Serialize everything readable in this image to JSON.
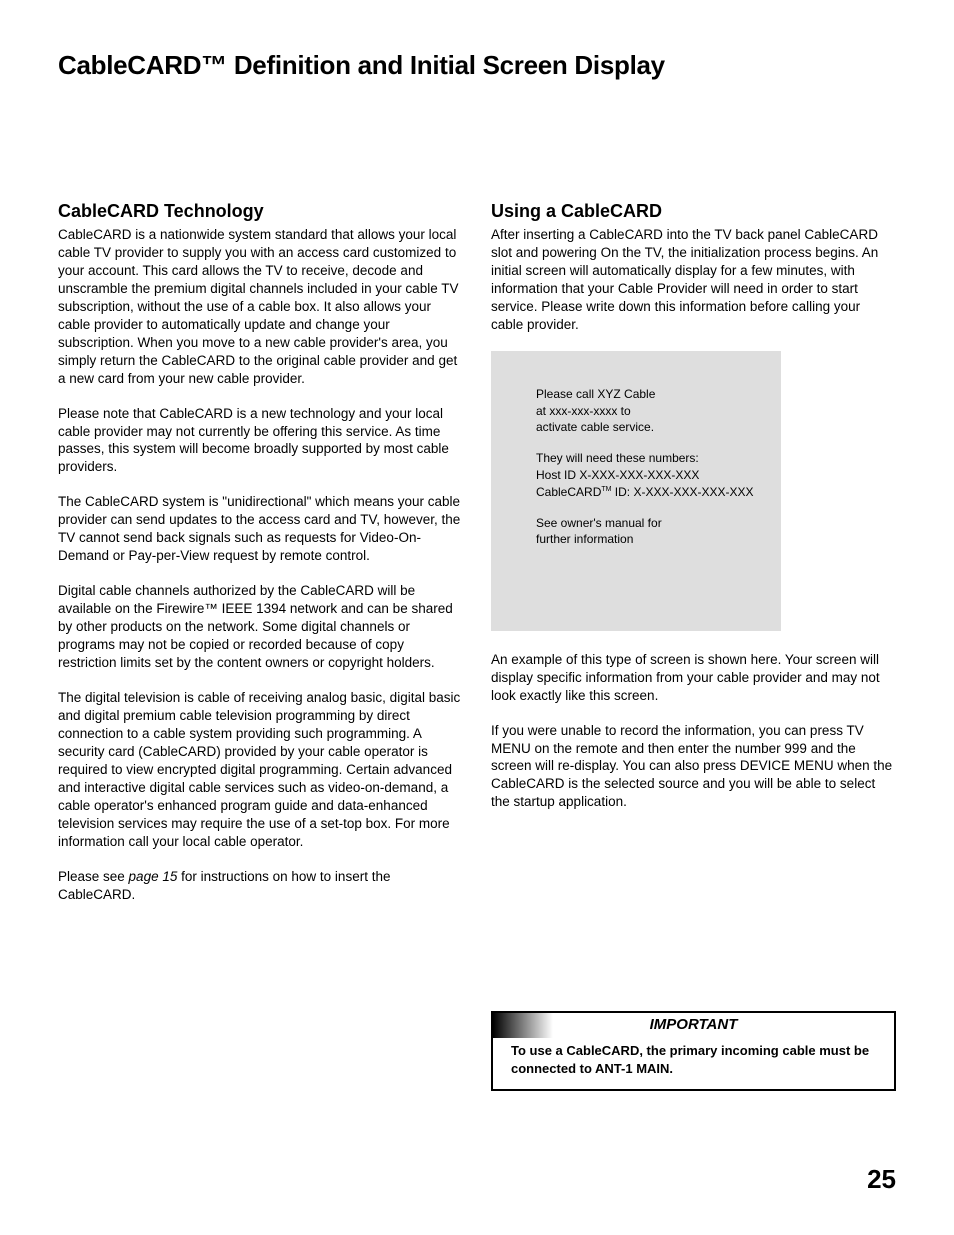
{
  "pageTitle": "CableCARD™  Definition and Initial Screen Display",
  "pageNumber": "25",
  "left": {
    "heading": "CableCARD Technology",
    "p1": "CableCARD is  a nationwide system standard that allows your local cable TV provider to supply you with an access card customized to your account. This card allows the TV to receive, decode and unscramble the premium digital channels included in your cable TV subscription, without the use of a cable box.  It also allows your cable provider to automatically update and change your subscription.  When you move to a new cable provider's area, you simply return the CableCARD to the original cable provider and get a new card from your new cable provider.",
    "p2": "Please note that CableCARD is a new technology and your local cable provider may not currently be offering this service.  As time passes, this system will become broadly supported by most cable providers.",
    "p3": "The CableCARD system is \"unidirectional\" which means your cable provider can send updates to the access card and TV, however, the TV cannot send back signals such as requests for Video-On-Demand or Pay-per-View request by remote control.",
    "p4": "Digital cable channels authorized by the CableCARD will be available on the Firewire™ IEEE 1394 network and can be shared by other products on the network.  Some digital channels or programs may not be copied or recorded because of copy restriction limits set by the content owners or copyright holders.",
    "p5": "The digital television is cable of receiving analog basic, digital basic and digital premium cable television programming by direct connection to a cable system providing such programming.  A security card (CableCARD) provided by your cable operator is required to view encrypted digital programming.  Certain advanced and interactive digital cable services such as video-on-demand, a cable operator's enhanced program guide and data-enhanced television services may require the use of a set-top box.  For more information call your local cable operator.",
    "p6a": "Please see ",
    "p6ref": "page 15",
    "p6b": " for instructions on how to insert the CableCARD."
  },
  "right": {
    "heading": "Using a CableCARD",
    "p1": "After inserting a CableCARD into the TV back panel CableCARD slot and powering On the TV, the initialization process begins.  An initial screen will automatically display for a few minutes, with information that your Cable Provider will need in order to start service.  Please write down this information before calling your cable provider.",
    "box": {
      "l1": "Please call XYZ Cable",
      "l2": "at xxx-xxx-xxxx  to",
      "l3": "activate cable service.",
      "l4": "They will need these numbers:",
      "l5": "Host ID X-XXX-XXX-XXX-XXX",
      "l6a": "CableCARD",
      "l6b": " ID: X-XXX-XXX-XXX-XXX",
      "l7": "See owner's manual for",
      "l8": "further information"
    },
    "p2": "An example of this type of screen is shown here.  Your screen will display specific information from your cable provider and may not look exactly like this screen.",
    "p3": "If you were unable to record the information, you can press TV MENU on the remote and then enter the number 999 and the screen will re-display.  You can also press DEVICE MENU when the CableCARD is the selected source and you will be able to select the startup application.",
    "important": {
      "title": "IMPORTANT",
      "body": "To use a CableCARD, the primary incoming cable must be connected to ANT-1 MAIN."
    }
  }
}
